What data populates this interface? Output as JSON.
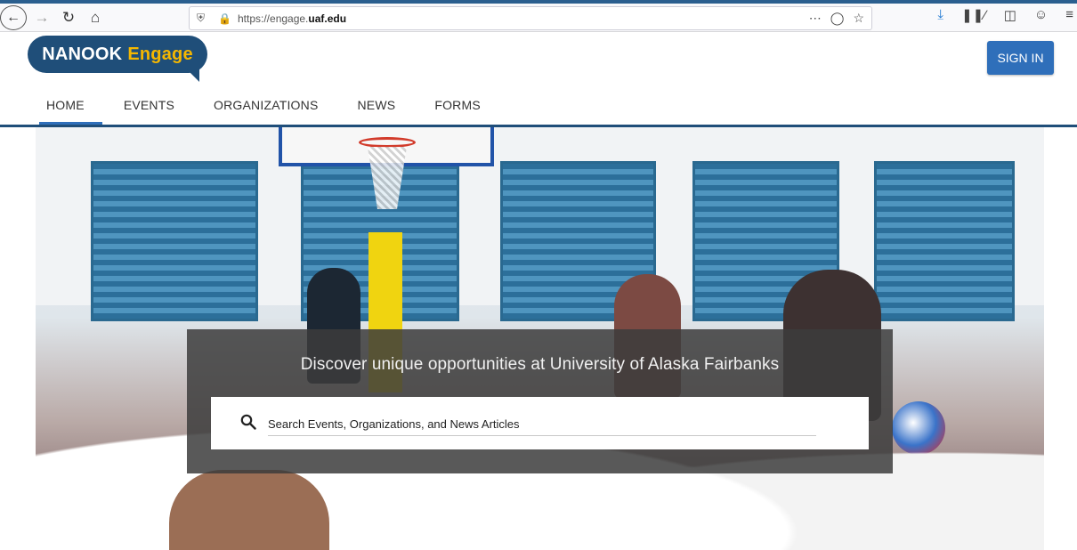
{
  "browser": {
    "url_prefix": "https://engage.",
    "url_domain": "uaf.edu",
    "url_actions": "⋯  ◻  ☆"
  },
  "site": {
    "logo_primary": "NANOOK",
    "logo_secondary": "Engage",
    "signin_label": "SIGN IN",
    "tabs": [
      {
        "label": "HOME"
      },
      {
        "label": "EVENTS"
      },
      {
        "label": "ORGANIZATIONS"
      },
      {
        "label": "NEWS"
      },
      {
        "label": "FORMS"
      }
    ]
  },
  "hero": {
    "tagline": "Discover unique opportunities at University of Alaska Fairbanks",
    "search_placeholder": "Search Events, Organizations, and News Articles"
  },
  "colors": {
    "brand_blue": "#1f4e79",
    "accent_yellow": "#f5b700",
    "button_blue": "#2f6fba"
  }
}
